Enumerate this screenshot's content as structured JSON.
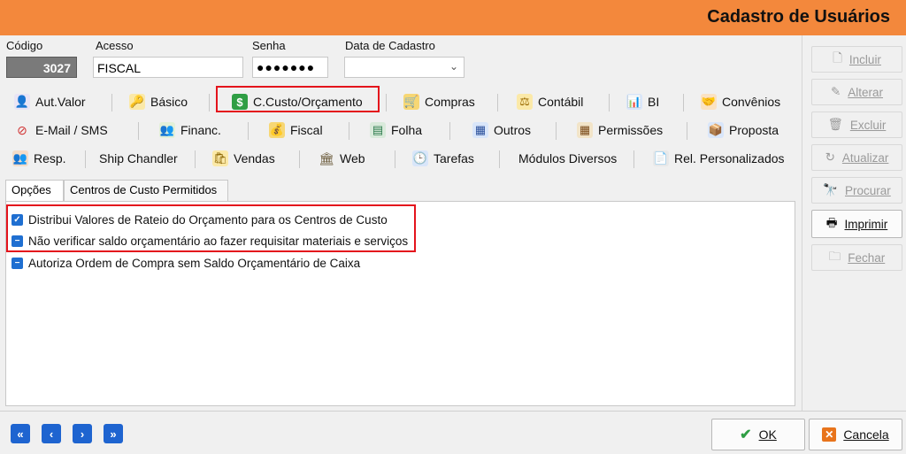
{
  "window": {
    "title": "Cadastro de Usuários"
  },
  "form": {
    "codigo": {
      "label": "Código",
      "value": "3027"
    },
    "acesso": {
      "label": "Acesso",
      "value": "FISCAL"
    },
    "senha": {
      "label": "Senha",
      "value": "●●●●●●●"
    },
    "data_cadastro": {
      "label": "Data de Cadastro",
      "value": ""
    }
  },
  "tabs": {
    "row1": [
      "Aut.Valor",
      "Básico",
      "C.Custo/Orçamento",
      "Compras",
      "Contábil",
      "BI",
      "Convênios"
    ],
    "row2": [
      "E-Mail / SMS",
      "Financ.",
      "Fiscal",
      "Folha",
      "Outros",
      "Permissões",
      "Proposta"
    ],
    "row3": [
      "Resp.",
      "Ship Chandler",
      "Vendas",
      "Web",
      "Tarefas",
      "Módulos Diversos",
      "Rel. Personalizados"
    ]
  },
  "subtabs": [
    "Opções",
    "Centros de Custo Permitidos"
  ],
  "options": [
    "Distribui Valores de Rateio do Orçamento para os Centros de Custo",
    "Não verificar saldo orçamentário ao fazer  requisitar materiais e serviços",
    "Autoriza Ordem de Compra sem Saldo Orçamentário de Caixa"
  ],
  "side_buttons": [
    "Incluir",
    "Alterar",
    "Excluir",
    "Atualizar",
    "Procurar",
    "Imprimir",
    "Fechar"
  ],
  "bottom": {
    "ok_label": "OK",
    "cancel_label": "Cancela"
  },
  "colors": {
    "title_bar": "#f3883c",
    "highlight": "#e4141c",
    "accent": "#1e64d0"
  }
}
